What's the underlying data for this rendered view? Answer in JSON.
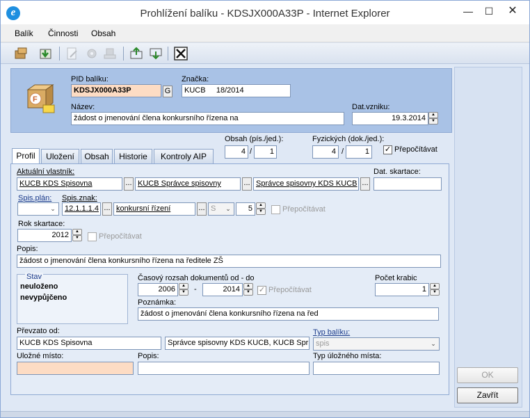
{
  "window": {
    "title": "Prohlížení balíku - KDSJX000A33P - Internet Explorer"
  },
  "menu": [
    "Balík",
    "Činnosti",
    "Obsah"
  ],
  "header": {
    "pid_label": "PID balíku:",
    "pid_value": "KDSJX000A33P",
    "g_button": "G",
    "znacka_label": "Značka:",
    "znacka_value": "KUCB     18/2014",
    "nazev_label": "Název:",
    "nazev_value": "žádost o jmenování člena konkursního řízena na",
    "datvzniku_label": "Dat.vzniku:",
    "datvzniku_value": "19.3.2014"
  },
  "counts": {
    "obsah_label": "Obsah (pís./jed.):",
    "obsah_pis": "4",
    "obsah_jed": "1",
    "fyz_label": "Fyzických (dok./jed.):",
    "fyz_dok": "4",
    "fyz_jed": "1",
    "slash": "/",
    "prepocitavat_label": "Přepočítávat"
  },
  "tabs": [
    "Profil",
    "Uložení",
    "Obsah",
    "Historie",
    "Kontroly AIP"
  ],
  "profil": {
    "vlastnik_label": "Aktuální vlastník:",
    "vlastnik1": "KUCB KDS Spisovna",
    "vlastnik2": "KUCB Správce spisovny",
    "vlastnik3": "Správce spisovny KDS KUCB",
    "datskartace_label": "Dat. skartace:",
    "datskartace_value": "",
    "spisplan_label": "Spis.plán:",
    "spisplan_value": "",
    "spisznak_label": "Spis.znak:",
    "spisznak_value": "12.1.1.1.4",
    "spisznak_name": "konkursní řízení",
    "skartznak_value": "S",
    "skartlhuta_value": "5",
    "prepocitavat_label": "Přepočítávat",
    "rokskartace_label": "Rok skartace:",
    "rokskartace_value": "2012",
    "popis_label": "Popis:",
    "popis_value": "žádost o jmenování člena konkursního řízena na ředitele ZŠ",
    "stav_label": "Stav",
    "stav1": "neuloženo",
    "stav2": "nevypůjčeno",
    "rozsah_label": "Časový rozsah dokumentů od - do",
    "rozsah_od": "2006",
    "rozsah_dash": "-",
    "rozsah_do": "2014",
    "pocetkrabic_label": "Počet krabic",
    "pocetkrabic_value": "1",
    "poznamka_label": "Poznámka:",
    "poznamka_value": "žádost o jmenování člena konkursního řízena na řed",
    "prevzato_label": "Převzato od:",
    "prevzato1": "KUCB KDS Spisovna",
    "prevzato2": "Správce spisovny KDS KUCB, KUCB Spr",
    "typbaliku_label": "Typ balíku:",
    "typbaliku_value": "spis",
    "ulozne_label": "Uložné místo:",
    "ulozne_value": "",
    "popis2_label": "Popis:",
    "popis2_value": "",
    "typulozne_label": "Typ úložného místa:",
    "typulozne_value": ""
  },
  "buttons": {
    "ok": "OK",
    "zavrit": "Zavřít"
  },
  "colors": {
    "required_field": "#fddcc4",
    "header_bg": "#a9c2e6"
  }
}
